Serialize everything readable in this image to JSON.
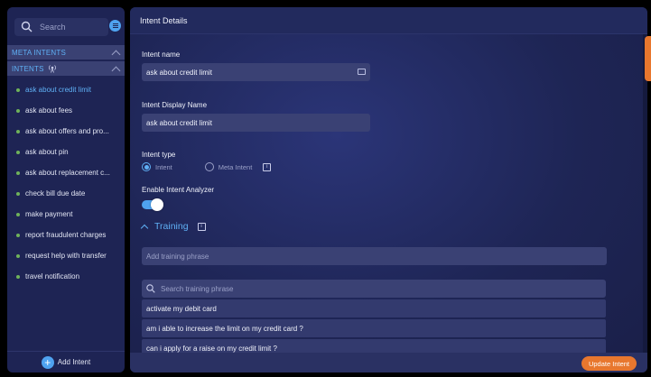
{
  "sidebar": {
    "search_placeholder": "Search",
    "meta_intents_label": "META INTENTS",
    "intents_label": "INTENTS",
    "items": [
      {
        "label": "ask about credit limit",
        "active": true
      },
      {
        "label": "ask about fees",
        "active": false
      },
      {
        "label": "ask about offers and pro...",
        "active": false
      },
      {
        "label": "ask about pin",
        "active": false
      },
      {
        "label": "ask about replacement c...",
        "active": false
      },
      {
        "label": "check bill due date",
        "active": false
      },
      {
        "label": "make payment",
        "active": false
      },
      {
        "label": "report fraudulent charges",
        "active": false
      },
      {
        "label": "request help with transfer",
        "active": false
      },
      {
        "label": "travel notification",
        "active": false
      }
    ],
    "add_intent_label": "Add Intent"
  },
  "main": {
    "header_title": "Intent Details",
    "intent_name_label": "Intent name",
    "intent_name_value": "ask about credit limit",
    "display_name_label": "Intent Display Name",
    "display_name_value": "ask about credit limit",
    "intent_type_label": "Intent type",
    "intent_type_options": [
      "Intent",
      "Meta Intent"
    ],
    "intent_type_selected": "Intent",
    "analyzer_label": "Enable Intent Analyzer",
    "analyzer_enabled": true,
    "training_label": "Training",
    "add_phrase_placeholder": "Add training phrase",
    "search_phrase_placeholder": "Search training phrase",
    "phrases": [
      "activate my debit card",
      "am i able to increase the limit on my credit card ?",
      "can i apply for a raise on my credit limit ?"
    ],
    "update_button_label": "Update Intent"
  },
  "colors": {
    "accent": "#5fb0f5",
    "primary_button": "#e8772e",
    "status_dot": "#6fb35a"
  }
}
